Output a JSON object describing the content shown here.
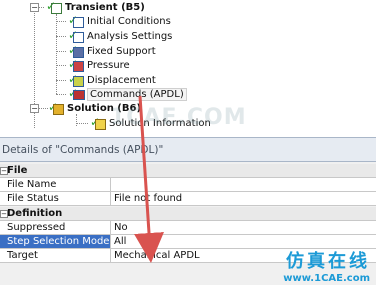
{
  "tree": {
    "root": {
      "label": "Transient (B5)",
      "expander": "−"
    },
    "children": [
      {
        "label": "Initial Conditions",
        "icon": "check-icon"
      },
      {
        "label": "Analysis Settings",
        "icon": "check-icon"
      },
      {
        "label": "Fixed Support",
        "icon": "check-icon"
      },
      {
        "label": "Pressure",
        "icon": "check-icon"
      },
      {
        "label": "Displacement",
        "icon": "check-icon"
      },
      {
        "label": "Commands (APDL)",
        "icon": "check-icon"
      }
    ],
    "solution": {
      "label": "Solution (B6)",
      "expander": "−"
    },
    "solution_children": [
      {
        "label": "Solution Information"
      }
    ]
  },
  "details": {
    "title": "Details of \"Commands (APDL)\"",
    "groups": [
      {
        "label": "File",
        "rows": [
          {
            "key": "File Name",
            "value": ""
          },
          {
            "key": "File Status",
            "value": "File not found"
          }
        ]
      },
      {
        "label": "Definition",
        "rows": [
          {
            "key": "Suppressed",
            "value": "No"
          },
          {
            "key": "Step Selection Mode",
            "value": "All"
          },
          {
            "key": "Target",
            "value": "Mechanical APDL"
          }
        ]
      }
    ]
  },
  "watermark": "1CAE.COM",
  "brand": {
    "chinese": "仿真在线",
    "url": "www.1CAE.com"
  },
  "colors": {
    "arrow": "#d9534f",
    "selection": "#3a6fc4",
    "brand": "#1c9ad6"
  }
}
